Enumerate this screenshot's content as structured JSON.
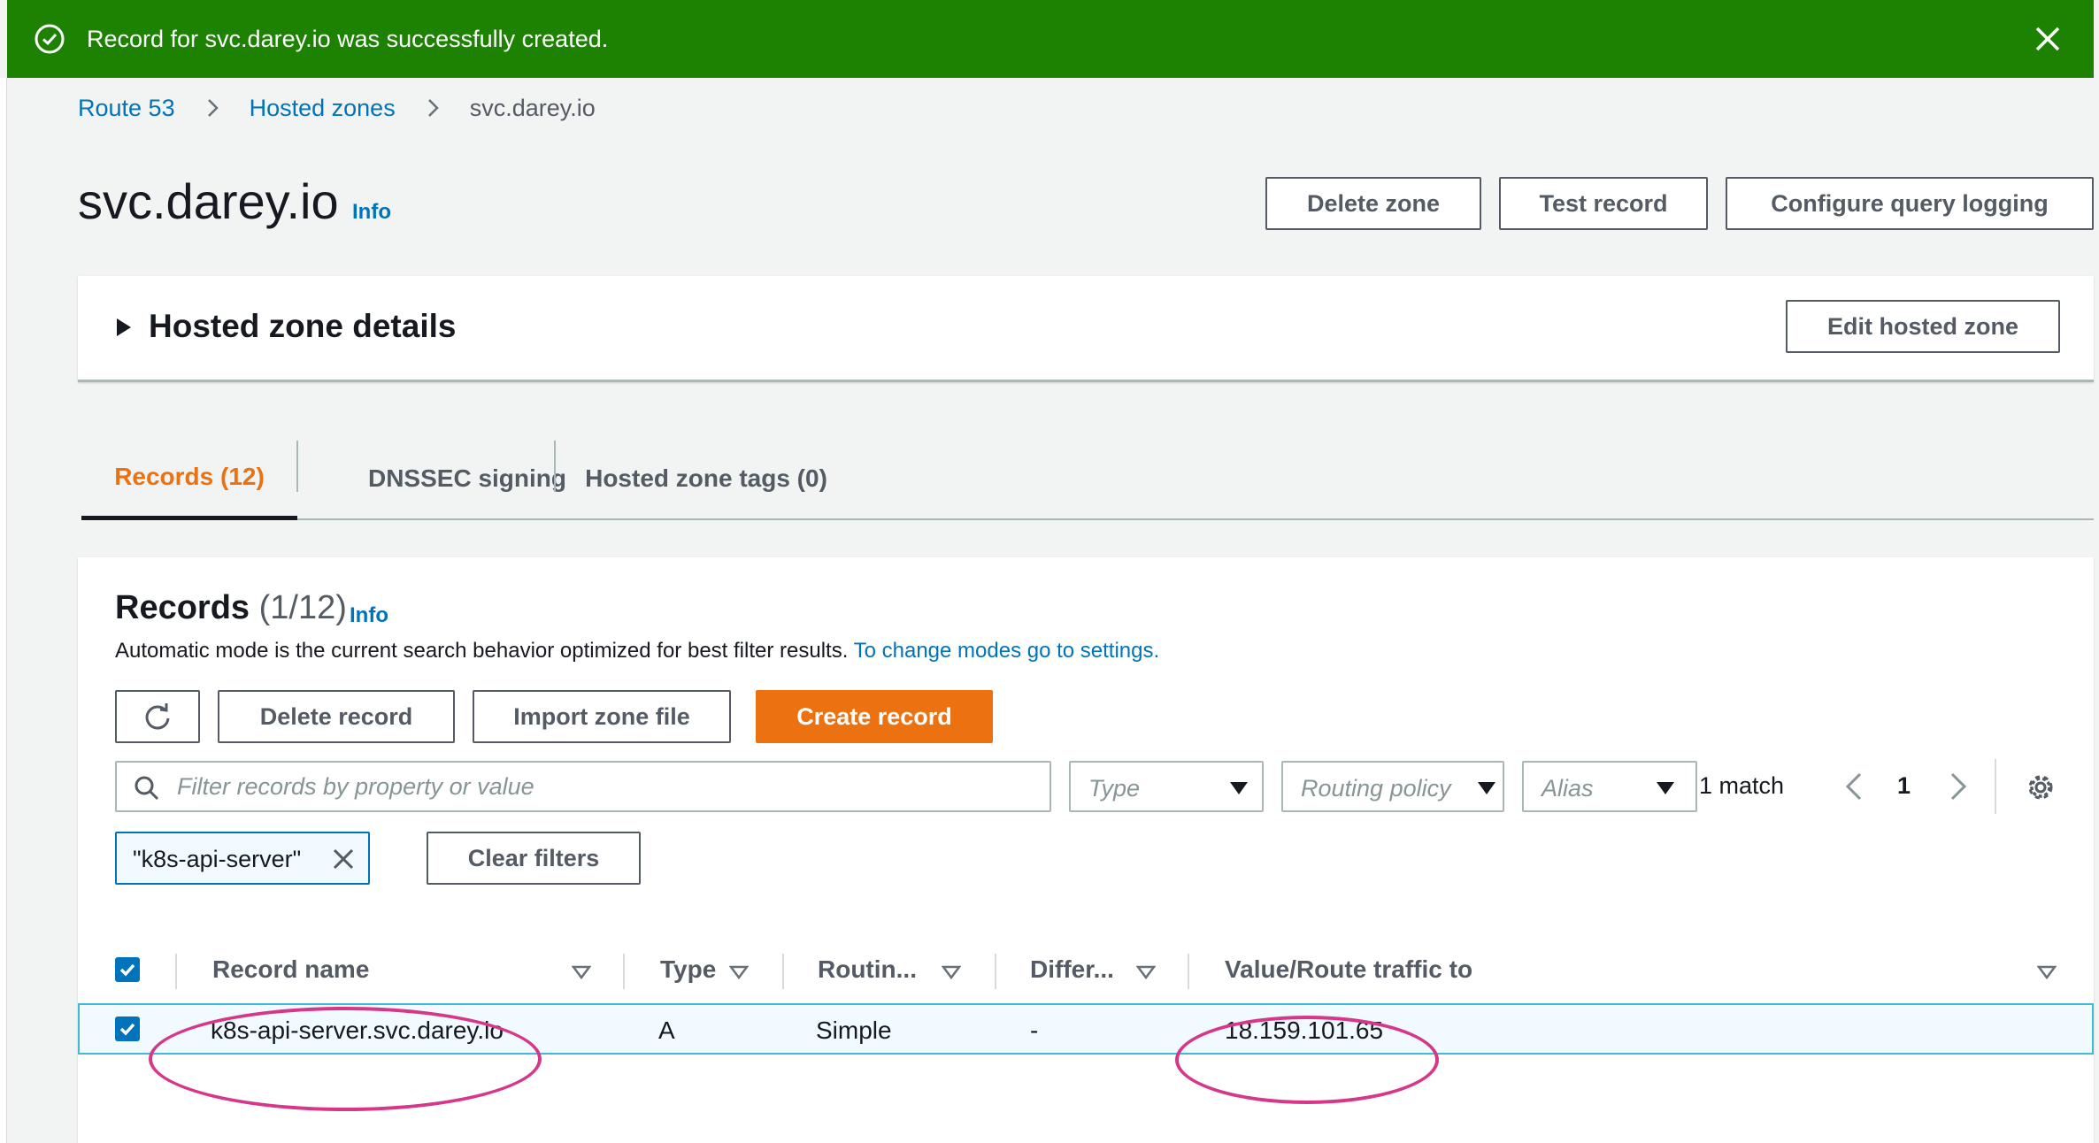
{
  "flash": {
    "message": "Record for svc.darey.io was successfully created."
  },
  "breadcrumb": {
    "items": [
      "Route 53",
      "Hosted zones"
    ],
    "current": "svc.darey.io"
  },
  "page": {
    "title": "svc.darey.io",
    "info": "Info",
    "buttons": {
      "delete_zone": "Delete zone",
      "test_record": "Test record",
      "configure_logging": "Configure query logging"
    }
  },
  "details": {
    "heading": "Hosted zone details",
    "edit_button": "Edit hosted zone"
  },
  "tabs": [
    {
      "label": "Records (12)",
      "active": true
    },
    {
      "label": "DNSSEC signing",
      "active": false
    },
    {
      "label": "Hosted zone tags (0)",
      "active": false
    }
  ],
  "records": {
    "heading": "Records",
    "count": "(1/12)",
    "info": "Info",
    "description": "Automatic mode is the current search behavior optimized for best filter results.",
    "settings_link": "To change modes go to settings.",
    "buttons": {
      "delete": "Delete record",
      "import": "Import zone file",
      "create": "Create record",
      "clear_filters": "Clear filters"
    },
    "search_placeholder": "Filter records by property or value",
    "filters": {
      "type": "Type",
      "routing_policy": "Routing policy",
      "alias": "Alias"
    },
    "match_text": "1 match",
    "page_number": "1",
    "filter_token": "\"k8s-api-server\"",
    "columns": [
      "Record name",
      "Type",
      "Routin...",
      "Differ...",
      "Value/Route traffic to"
    ],
    "rows": [
      {
        "name": "k8s-api-server.svc.darey.io",
        "type": "A",
        "routing": "Simple",
        "differentiator": "-",
        "value": "18.159.101.65"
      }
    ]
  },
  "colors": {
    "success_green": "#1d8102",
    "link_blue": "#0073bb",
    "primary_orange": "#ec7211",
    "annotation_pink": "#d6378a"
  }
}
